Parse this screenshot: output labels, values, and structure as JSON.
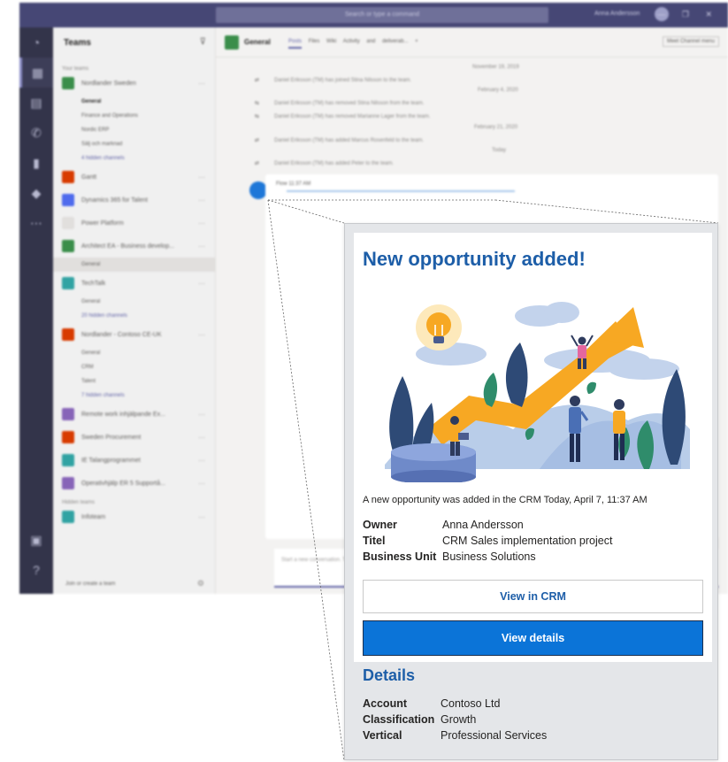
{
  "background": {
    "search_placeholder": "Search or type a command",
    "user_name": "Anna Andersson",
    "window_controls": "— ❐ ✕",
    "teamlist": {
      "title": "Teams",
      "section_your_teams": "Your teams",
      "section_hidden_teams": "Hidden teams",
      "join_label": "Join or create a team",
      "teams": [
        {
          "name": "Nordlander Sweden",
          "color": "#3a8e4a",
          "channels": [
            "General",
            "Finance and Operations",
            "Nordic ERP",
            "Sälj och marknad",
            "4 hidden channels"
          ]
        },
        {
          "name": "Gantt",
          "color": "#d83b01",
          "channels": []
        },
        {
          "name": "Dynamics 365 for Talent",
          "color": "#4f6bed",
          "channels": []
        },
        {
          "name": "Power Platform",
          "color": "#e1dfdd",
          "channels": []
        },
        {
          "name": "Architect EA - Business develop...",
          "color": "#3a8e4a",
          "channels": [
            "General"
          ]
        },
        {
          "name": "TechTalk",
          "color": "#31a3a3",
          "channels": [
            "General",
            "20 hidden channels"
          ]
        },
        {
          "name": "Nordlander - Contoso CE-UK",
          "color": "#d83b01",
          "channels": [
            "General",
            "CRM",
            "Talent",
            "7 hidden channels"
          ]
        },
        {
          "name": "Remote work inhjälpande Ex...",
          "color": "#8764b8",
          "channels": []
        },
        {
          "name": "Sweden Procurement",
          "color": "#d83b01",
          "channels": []
        },
        {
          "name": "IE Talangprogrammet",
          "color": "#31a3a3",
          "channels": []
        },
        {
          "name": "Operativhjälp ER 5 Supportå...",
          "color": "#8764b8",
          "channels": []
        }
      ],
      "hidden_teams": [
        {
          "name": "Infoteam",
          "color": "#31a3a3"
        }
      ]
    },
    "channel_header": {
      "name": "General",
      "tabs": [
        "Posts",
        "Files",
        "Wiki",
        "Activity and deliverab...",
        "+"
      ],
      "actions": "Meet   Channel menu"
    },
    "feed": {
      "dates": [
        "November 19, 2019",
        "February 4, 2020",
        "February 21, 2020",
        "Today"
      ],
      "events": [
        "Daniel Eriksson (TM) has joined Stina Nilsson to the team.",
        "Daniel Eriksson (TM) has removed Stina Nilsson from the team.",
        "Daniel Eriksson (TM) has removed Marianne Lager from the team.",
        "Daniel Eriksson (TM) has added Marcus Rosenfeld to the team.",
        "Daniel Eriksson (TM) has added Peter to the team."
      ],
      "bot_author": "Flow   11:37 AM",
      "composer_placeholder": "Start a new conversation. Type @ to mention someone."
    }
  },
  "card": {
    "title": "New opportunity added!",
    "text": "A new opportunity was added in the CRM Today, April 7, 11:37 AM",
    "facts": [
      {
        "key": "Owner",
        "value": "Anna Andersson"
      },
      {
        "key": "Titel",
        "value": "CRM Sales implementation project"
      },
      {
        "key": "Business Unit",
        "value": "Business Solutions"
      }
    ],
    "button_secondary": "View in CRM",
    "button_primary": "View details",
    "details_title": "Details",
    "details_facts": [
      {
        "key": "Account",
        "value": "Contoso Ltd"
      },
      {
        "key": "Classification",
        "value": "Growth"
      },
      {
        "key": "Vertical",
        "value": "Professional Services"
      }
    ],
    "colors": {
      "accent": "#1d5ea8",
      "primary_button": "#0b74d8",
      "arrow": "#f7a823"
    }
  }
}
